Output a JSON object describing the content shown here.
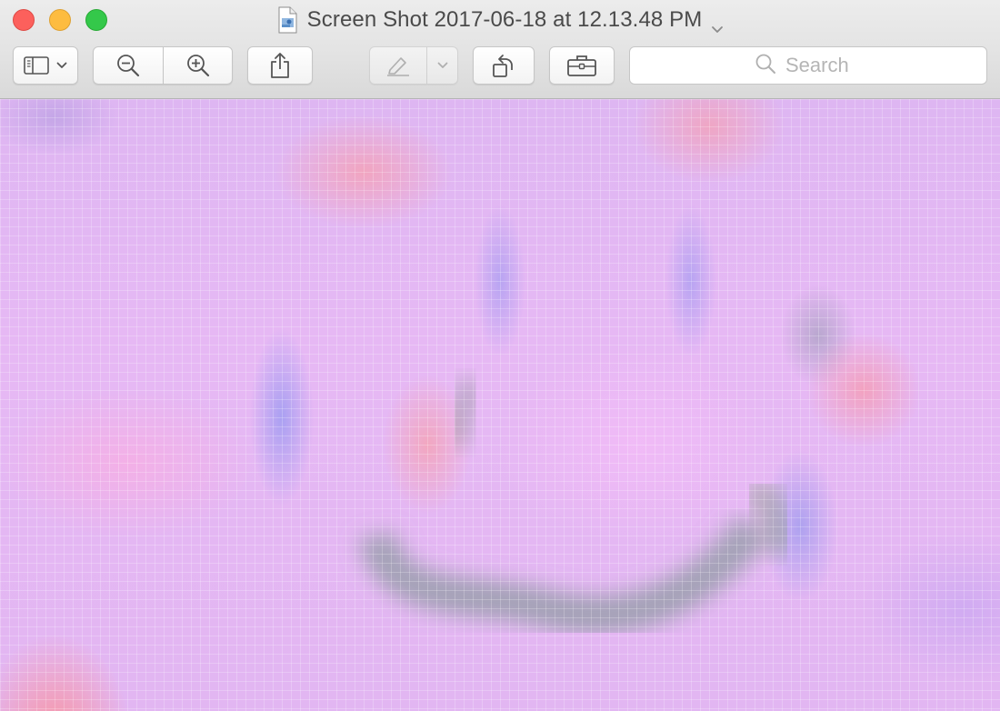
{
  "window": {
    "title": "Screen Shot 2017-06-18 at 12.13.48 PM",
    "traffic_lights": {
      "close": "#fc605c",
      "minimize": "#fdbc40",
      "zoom": "#34c84a"
    }
  },
  "toolbar": {
    "buttons": [
      {
        "name": "sidebar-toggle",
        "icon": "sidebar-icon",
        "has_dropdown": true
      },
      {
        "name": "zoom-out",
        "icon": "zoom-out-icon"
      },
      {
        "name": "zoom-in",
        "icon": "zoom-in-icon"
      },
      {
        "name": "share",
        "icon": "share-icon"
      },
      {
        "name": "markup-pen",
        "icon": "pen-icon",
        "has_dropdown": true,
        "enabled": false
      },
      {
        "name": "rotate",
        "icon": "rotate-left-icon"
      },
      {
        "name": "markup-toolbox",
        "icon": "toolbox-icon"
      }
    ],
    "search": {
      "placeholder": "Search",
      "value": ""
    }
  },
  "content": {
    "image": "pixelated-image",
    "dominant_color": "#e2b8f3"
  }
}
